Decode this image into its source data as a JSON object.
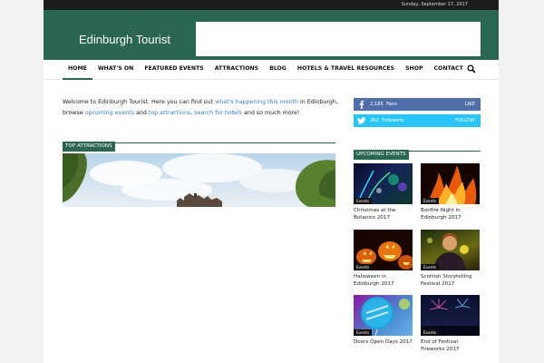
{
  "topbar": {
    "date": "Sunday, September 17, 2017"
  },
  "header": {
    "logo": "Edinburgh Tourist"
  },
  "nav": {
    "items": [
      "Home",
      "What's On",
      "Featured Events",
      "Attractions",
      "Blog",
      "Hotels & Travel Resources",
      "Shop",
      "Contact"
    ],
    "active_index": 0,
    "search_icon": "search-icon"
  },
  "intro": {
    "t1": "Welcome to Edinburgh Tourist. Here you can find out ",
    "l1": "what's happening this month",
    "t2": " in Edinburgh, browse ",
    "l2": "upcoming events",
    "t3": " and ",
    "l3": "top attractions",
    "t4": ", ",
    "l4": "search for hotels",
    "t5": " and so much more!"
  },
  "attractions": {
    "title": "TOP ATTRACTIONS"
  },
  "social": {
    "facebook": {
      "count": "2,185",
      "unit": "Fans",
      "action": "LIKE",
      "icon": "facebook-icon",
      "color": "#516eab"
    },
    "twitter": {
      "count": "262",
      "unit": "Followers",
      "action": "FOLLOW",
      "icon": "twitter-icon",
      "color": "#29c5f6"
    }
  },
  "upcoming": {
    "title": "UPCOMING EVENTS",
    "events": [
      {
        "tag": "Events",
        "name": "Christmas at the Botanics 2017"
      },
      {
        "tag": "Events",
        "name": "Bonfire Night in Edinburgh 2017"
      },
      {
        "tag": "Events",
        "name": "Halloween in Edinburgh 2017"
      },
      {
        "tag": "Events",
        "name": "Scottish Storytelling Festival 2017"
      },
      {
        "tag": "Events",
        "name": "Doors Open Days 2017"
      },
      {
        "tag": "Events",
        "name": "End of Festival Fireworks 2017"
      }
    ]
  },
  "colors": {
    "brand": "#2a6651",
    "link": "#3a7fb8"
  }
}
